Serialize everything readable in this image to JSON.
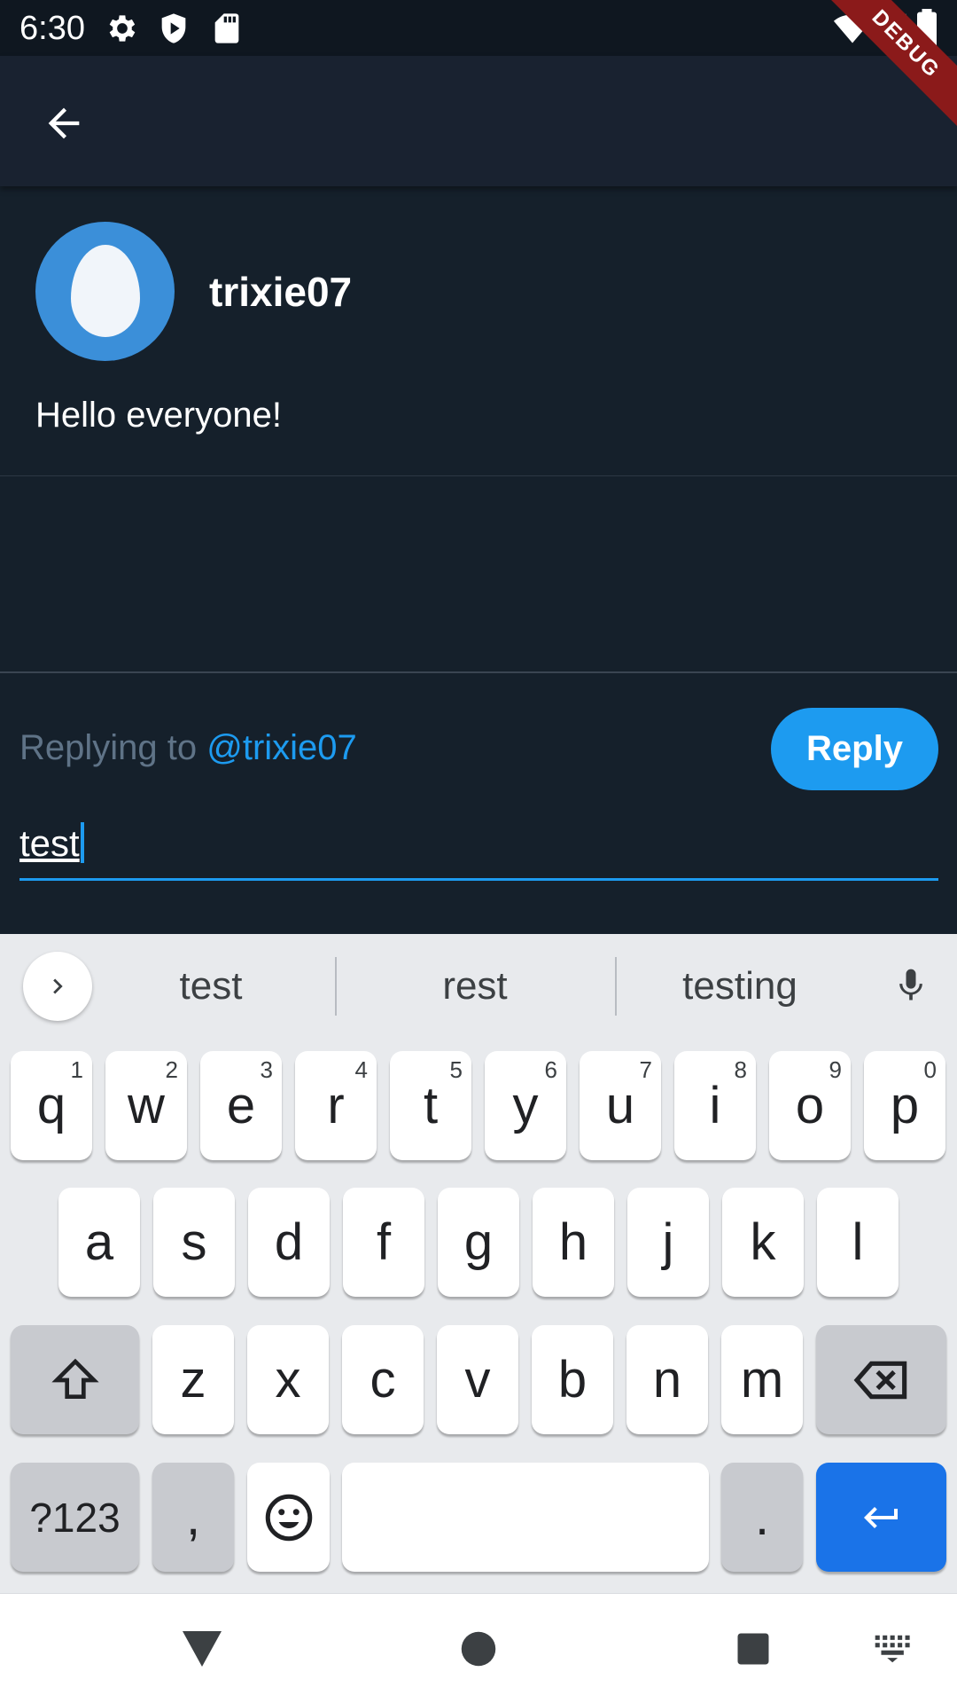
{
  "status_bar": {
    "time": "6:30",
    "left_icons": [
      "settings-icon",
      "shield-icon",
      "sd-card-icon"
    ],
    "right_icons": [
      "wifi-icon",
      "signal-icon",
      "battery-icon"
    ],
    "debug_label": "DEBUG"
  },
  "app_bar": {
    "back_icon": "arrow-back-icon"
  },
  "tweet": {
    "username": "trixie07",
    "text": "Hello everyone!",
    "avatar_color": "#3b8fd9"
  },
  "composer": {
    "replying_prefix": "Replying to ",
    "replying_handle": "@trixie07",
    "reply_label": "Reply",
    "input_value": "test",
    "accent_color": "#1d9bf0"
  },
  "keyboard": {
    "suggestions": [
      "test",
      "rest",
      "testing"
    ],
    "row1": [
      {
        "key": "q",
        "hint": "1"
      },
      {
        "key": "w",
        "hint": "2"
      },
      {
        "key": "e",
        "hint": "3"
      },
      {
        "key": "r",
        "hint": "4"
      },
      {
        "key": "t",
        "hint": "5"
      },
      {
        "key": "y",
        "hint": "6"
      },
      {
        "key": "u",
        "hint": "7"
      },
      {
        "key": "i",
        "hint": "8"
      },
      {
        "key": "o",
        "hint": "9"
      },
      {
        "key": "p",
        "hint": "0"
      }
    ],
    "row2": [
      "a",
      "s",
      "d",
      "f",
      "g",
      "h",
      "j",
      "k",
      "l"
    ],
    "row3": [
      "z",
      "x",
      "c",
      "v",
      "b",
      "n",
      "m"
    ],
    "symbols_label": "?123",
    "comma_label": ",",
    "period_label": "."
  },
  "nav_bar": {
    "icons": [
      "back-triangle-icon",
      "home-circle-icon",
      "recents-square-icon",
      "keyboard-switch-icon"
    ]
  }
}
